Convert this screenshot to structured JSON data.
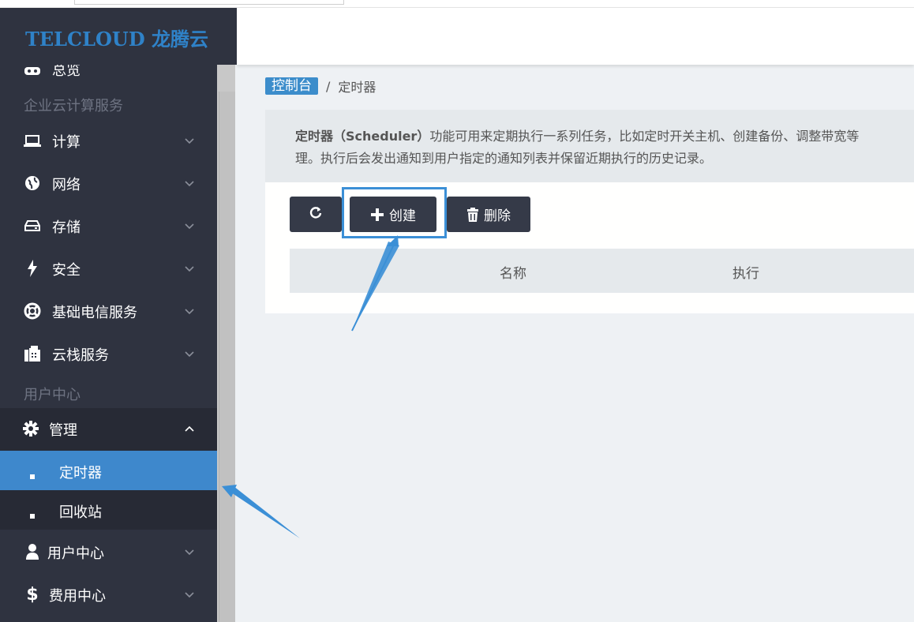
{
  "brand": {
    "logo": "TELCLOUD 龙腾云",
    "accent": "#2f82c8"
  },
  "sidebar": {
    "overview": "总览",
    "section1": "企业云计算服务",
    "items": [
      {
        "label": "计算",
        "icon": "laptop-icon"
      },
      {
        "label": "网络",
        "icon": "globe-icon"
      },
      {
        "label": "存储",
        "icon": "hdd-icon"
      },
      {
        "label": "安全",
        "icon": "bolt-icon"
      },
      {
        "label": "基础电信服务",
        "icon": "lifebuoy-icon"
      },
      {
        "label": "云栈服务",
        "icon": "fax-icon"
      }
    ],
    "section2": "用户中心",
    "manage": {
      "label": "管理",
      "icon": "gear-icon"
    },
    "subitems": [
      {
        "label": "定时器",
        "active": true
      },
      {
        "label": "回收站",
        "active": false
      }
    ],
    "user_center": {
      "label": "用户中心",
      "icon": "user-icon"
    },
    "billing": {
      "label": "费用中心",
      "icon": "dollar-icon"
    }
  },
  "breadcrumb": {
    "home": "控制台",
    "separator": "/",
    "current": "定时器"
  },
  "description": {
    "title": "定时器（Scheduler）",
    "line1": "功能可用来定期执行一系列任务，比如定时开关主机、创建备份、调整带宽等",
    "line2": "理。执行后会发出通知到用户指定的通知列表并保留近期执行的历史记录。"
  },
  "toolbar": {
    "create": "创建",
    "delete": "删除"
  },
  "table": {
    "columns": [
      "名称",
      "执行"
    ]
  }
}
